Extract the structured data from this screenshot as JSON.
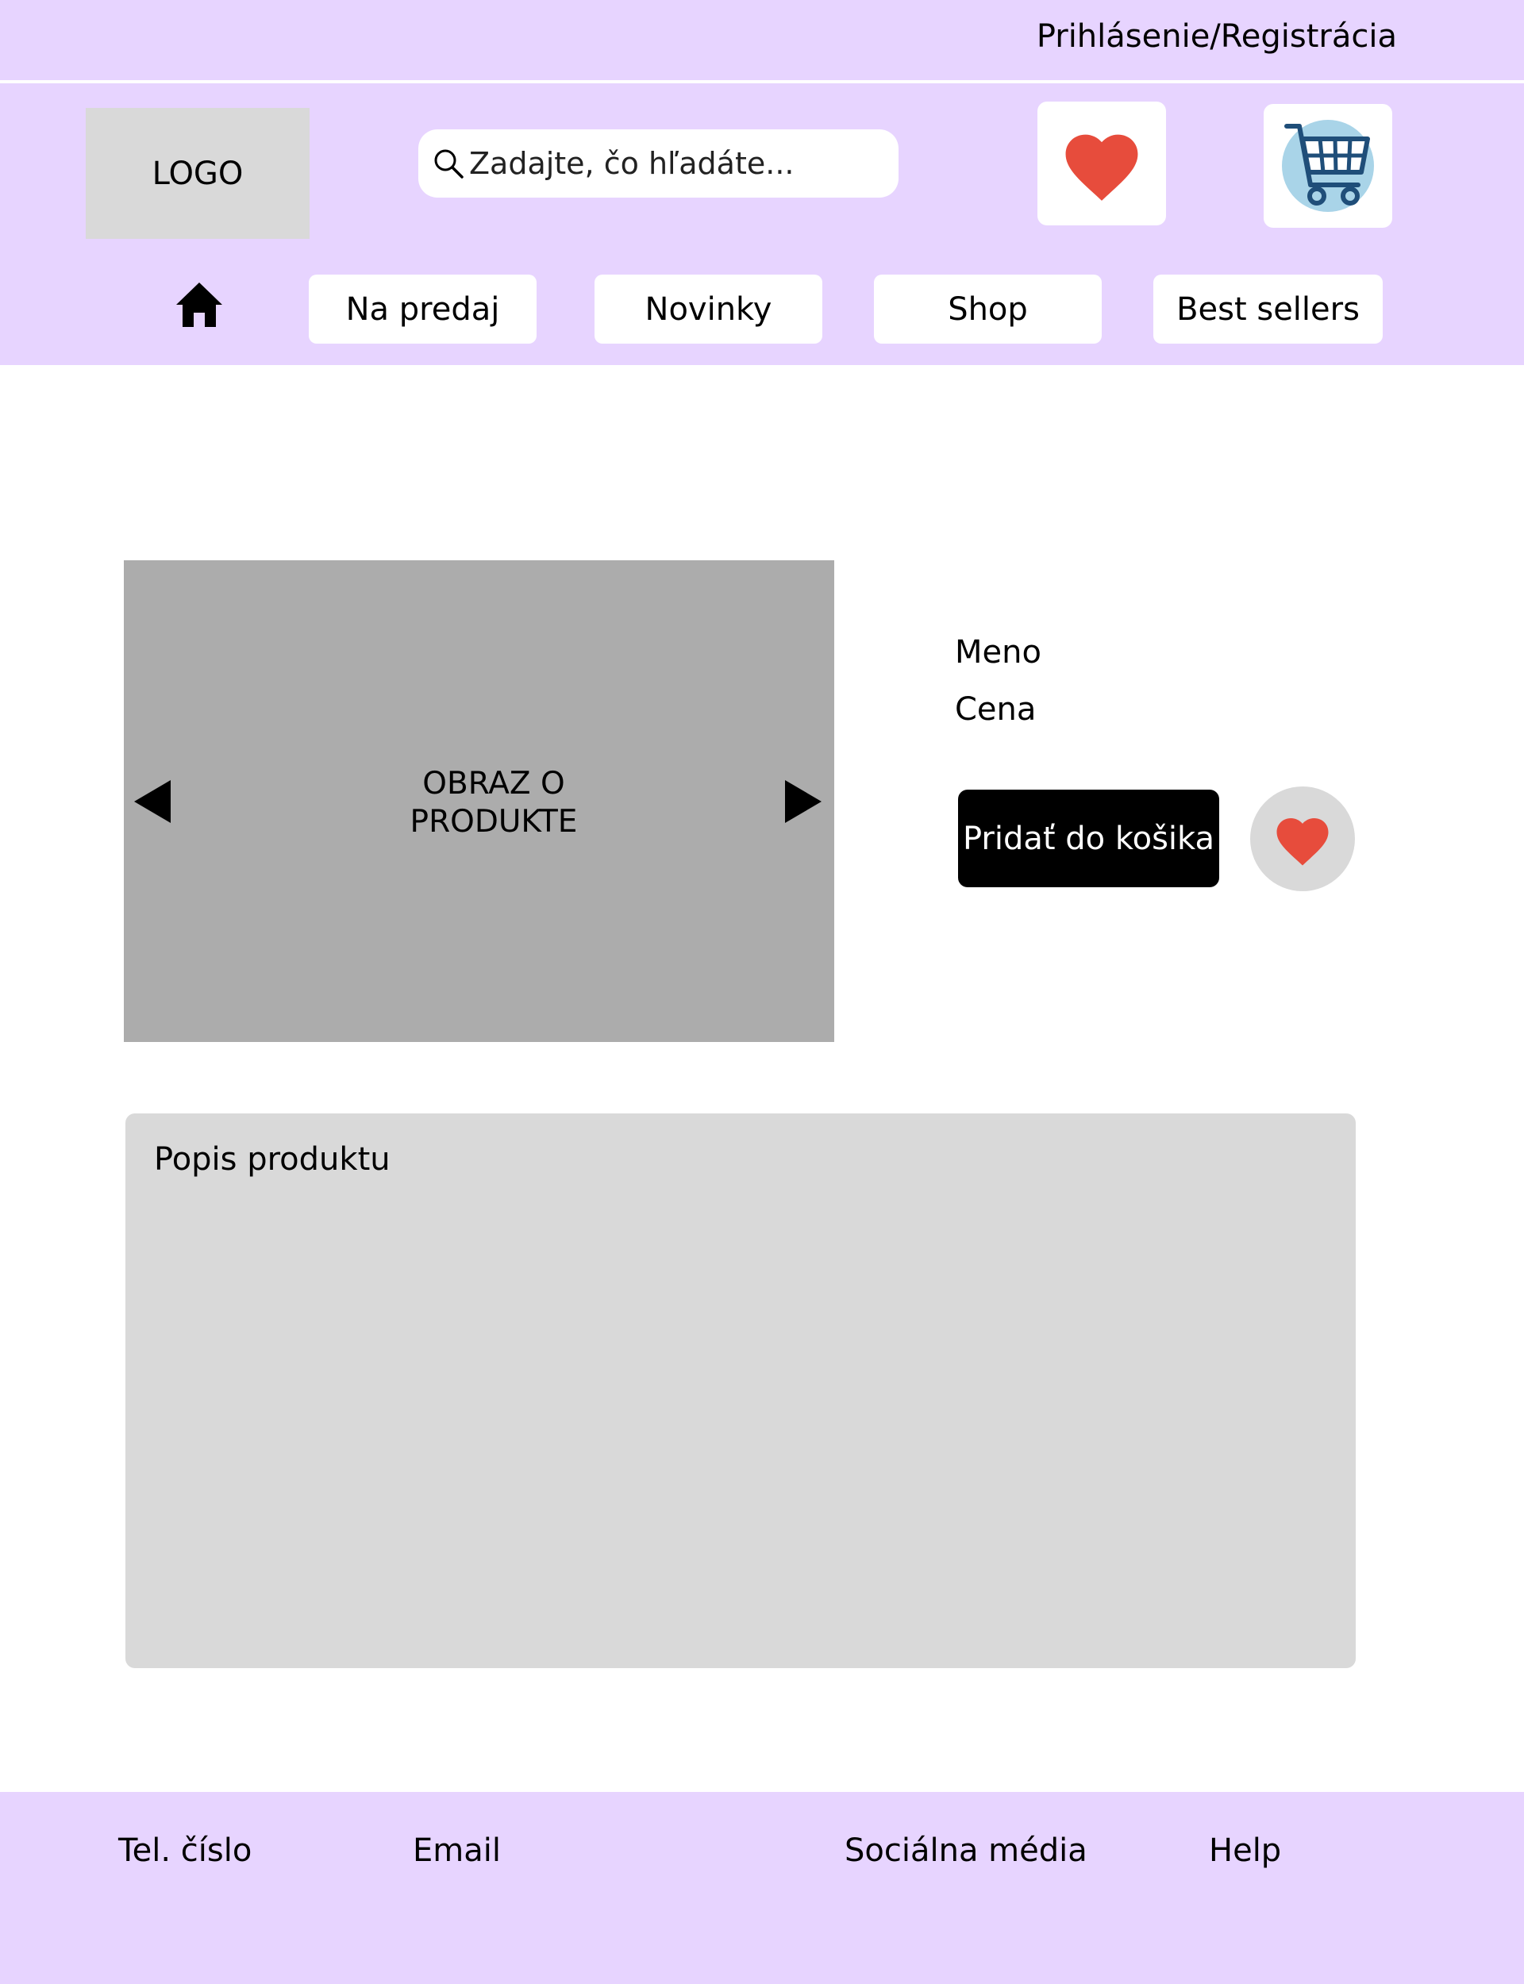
{
  "header": {
    "auth_link": "Prihlásenie/Registrácia",
    "logo_text": "LOGO",
    "search": {
      "placeholder": "Zadajte, čo hľadáte...",
      "value": "",
      "icon": "search-icon"
    },
    "wishlist_icon": "heart-icon",
    "cart_icon": "shopping-cart-icon",
    "home_icon": "home-icon",
    "nav": [
      {
        "label": "Na predaj"
      },
      {
        "label": "Novinky"
      },
      {
        "label": "Shop"
      },
      {
        "label": "Best sellers"
      }
    ]
  },
  "product": {
    "image_label_line1": "OBRAZ O",
    "image_label_line2": "PRODUKTE",
    "prev_icon": "arrow-left-icon",
    "next_icon": "arrow-right-icon",
    "name": "Meno",
    "price": "Cena",
    "add_to_cart_label": "Pridať do košika",
    "favorite_icon": "heart-icon",
    "description_title": "Popis produktu"
  },
  "footer": {
    "phone": "Tel. číslo",
    "email": "Email",
    "social": "Sociálna média",
    "help": "Help"
  },
  "colors": {
    "header_bg": "#e7d4ff",
    "footer_bg": "#e7d4ff",
    "heart": "#e74c3c",
    "cart_circle": "#a9d4e8",
    "cart_stroke": "#1f4e79",
    "image_placeholder": "#acacac",
    "panel_gray": "#d9d9d9",
    "primary_button": "#000000"
  }
}
